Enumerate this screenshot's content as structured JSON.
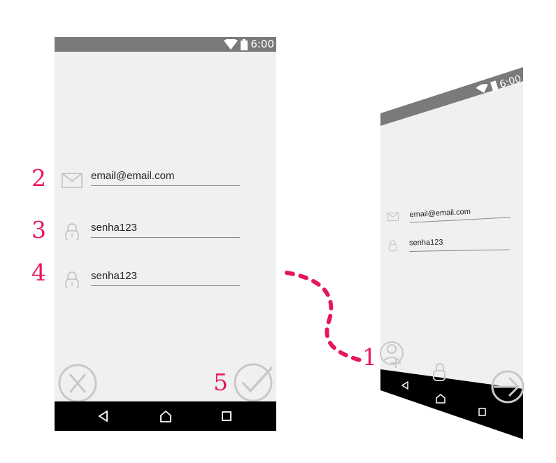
{
  "status_bar": {
    "time": "6:00"
  },
  "signup_form": {
    "email_value": "email@email.com",
    "password_value": "senha123",
    "confirm_password_value": "senha123"
  },
  "login_form": {
    "email_value": "email@email.com",
    "password_value": "senha123"
  },
  "annotations": {
    "step_1": "1",
    "step_2": "2",
    "step_3": "3",
    "step_4": "4",
    "step_5": "5"
  },
  "icons": {
    "status": [
      "wifi-icon",
      "battery-icon"
    ],
    "nav": [
      "back-icon",
      "home-icon",
      "recents-icon"
    ],
    "signup_actions": [
      "cancel-icon",
      "confirm-icon"
    ],
    "login_actions": [
      "add-user-icon",
      "forgot-password-icon",
      "login-arrow-icon"
    ],
    "fields": [
      "envelope-icon",
      "lock-icon"
    ]
  },
  "colors": {
    "accent": "#e8175d",
    "status_bar": "#7a7a7a",
    "screen_bg": "#f0f0f0",
    "nav_bar": "#000000",
    "icon_gray": "#bdbdbd"
  }
}
